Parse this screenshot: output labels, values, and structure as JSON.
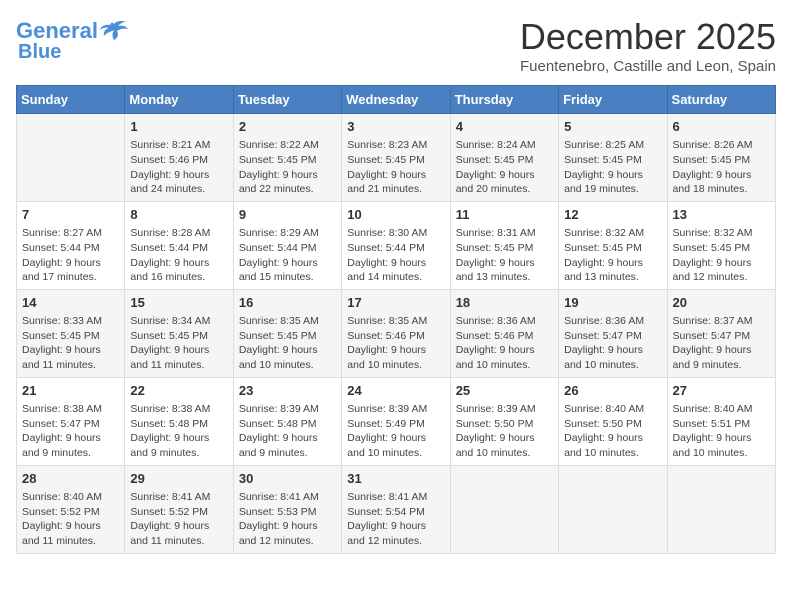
{
  "header": {
    "logo_line1": "General",
    "logo_line2": "Blue",
    "month": "December 2025",
    "location": "Fuentenebro, Castille and Leon, Spain"
  },
  "weekdays": [
    "Sunday",
    "Monday",
    "Tuesday",
    "Wednesday",
    "Thursday",
    "Friday",
    "Saturday"
  ],
  "weeks": [
    [
      {
        "day": "",
        "info": ""
      },
      {
        "day": "1",
        "info": "Sunrise: 8:21 AM\nSunset: 5:46 PM\nDaylight: 9 hours\nand 24 minutes."
      },
      {
        "day": "2",
        "info": "Sunrise: 8:22 AM\nSunset: 5:45 PM\nDaylight: 9 hours\nand 22 minutes."
      },
      {
        "day": "3",
        "info": "Sunrise: 8:23 AM\nSunset: 5:45 PM\nDaylight: 9 hours\nand 21 minutes."
      },
      {
        "day": "4",
        "info": "Sunrise: 8:24 AM\nSunset: 5:45 PM\nDaylight: 9 hours\nand 20 minutes."
      },
      {
        "day": "5",
        "info": "Sunrise: 8:25 AM\nSunset: 5:45 PM\nDaylight: 9 hours\nand 19 minutes."
      },
      {
        "day": "6",
        "info": "Sunrise: 8:26 AM\nSunset: 5:45 PM\nDaylight: 9 hours\nand 18 minutes."
      }
    ],
    [
      {
        "day": "7",
        "info": "Sunrise: 8:27 AM\nSunset: 5:44 PM\nDaylight: 9 hours\nand 17 minutes."
      },
      {
        "day": "8",
        "info": "Sunrise: 8:28 AM\nSunset: 5:44 PM\nDaylight: 9 hours\nand 16 minutes."
      },
      {
        "day": "9",
        "info": "Sunrise: 8:29 AM\nSunset: 5:44 PM\nDaylight: 9 hours\nand 15 minutes."
      },
      {
        "day": "10",
        "info": "Sunrise: 8:30 AM\nSunset: 5:44 PM\nDaylight: 9 hours\nand 14 minutes."
      },
      {
        "day": "11",
        "info": "Sunrise: 8:31 AM\nSunset: 5:45 PM\nDaylight: 9 hours\nand 13 minutes."
      },
      {
        "day": "12",
        "info": "Sunrise: 8:32 AM\nSunset: 5:45 PM\nDaylight: 9 hours\nand 13 minutes."
      },
      {
        "day": "13",
        "info": "Sunrise: 8:32 AM\nSunset: 5:45 PM\nDaylight: 9 hours\nand 12 minutes."
      }
    ],
    [
      {
        "day": "14",
        "info": "Sunrise: 8:33 AM\nSunset: 5:45 PM\nDaylight: 9 hours\nand 11 minutes."
      },
      {
        "day": "15",
        "info": "Sunrise: 8:34 AM\nSunset: 5:45 PM\nDaylight: 9 hours\nand 11 minutes."
      },
      {
        "day": "16",
        "info": "Sunrise: 8:35 AM\nSunset: 5:45 PM\nDaylight: 9 hours\nand 10 minutes."
      },
      {
        "day": "17",
        "info": "Sunrise: 8:35 AM\nSunset: 5:46 PM\nDaylight: 9 hours\nand 10 minutes."
      },
      {
        "day": "18",
        "info": "Sunrise: 8:36 AM\nSunset: 5:46 PM\nDaylight: 9 hours\nand 10 minutes."
      },
      {
        "day": "19",
        "info": "Sunrise: 8:36 AM\nSunset: 5:47 PM\nDaylight: 9 hours\nand 10 minutes."
      },
      {
        "day": "20",
        "info": "Sunrise: 8:37 AM\nSunset: 5:47 PM\nDaylight: 9 hours\nand 9 minutes."
      }
    ],
    [
      {
        "day": "21",
        "info": "Sunrise: 8:38 AM\nSunset: 5:47 PM\nDaylight: 9 hours\nand 9 minutes."
      },
      {
        "day": "22",
        "info": "Sunrise: 8:38 AM\nSunset: 5:48 PM\nDaylight: 9 hours\nand 9 minutes."
      },
      {
        "day": "23",
        "info": "Sunrise: 8:39 AM\nSunset: 5:48 PM\nDaylight: 9 hours\nand 9 minutes."
      },
      {
        "day": "24",
        "info": "Sunrise: 8:39 AM\nSunset: 5:49 PM\nDaylight: 9 hours\nand 10 minutes."
      },
      {
        "day": "25",
        "info": "Sunrise: 8:39 AM\nSunset: 5:50 PM\nDaylight: 9 hours\nand 10 minutes."
      },
      {
        "day": "26",
        "info": "Sunrise: 8:40 AM\nSunset: 5:50 PM\nDaylight: 9 hours\nand 10 minutes."
      },
      {
        "day": "27",
        "info": "Sunrise: 8:40 AM\nSunset: 5:51 PM\nDaylight: 9 hours\nand 10 minutes."
      }
    ],
    [
      {
        "day": "28",
        "info": "Sunrise: 8:40 AM\nSunset: 5:52 PM\nDaylight: 9 hours\nand 11 minutes."
      },
      {
        "day": "29",
        "info": "Sunrise: 8:41 AM\nSunset: 5:52 PM\nDaylight: 9 hours\nand 11 minutes."
      },
      {
        "day": "30",
        "info": "Sunrise: 8:41 AM\nSunset: 5:53 PM\nDaylight: 9 hours\nand 12 minutes."
      },
      {
        "day": "31",
        "info": "Sunrise: 8:41 AM\nSunset: 5:54 PM\nDaylight: 9 hours\nand 12 minutes."
      },
      {
        "day": "",
        "info": ""
      },
      {
        "day": "",
        "info": ""
      },
      {
        "day": "",
        "info": ""
      }
    ]
  ]
}
